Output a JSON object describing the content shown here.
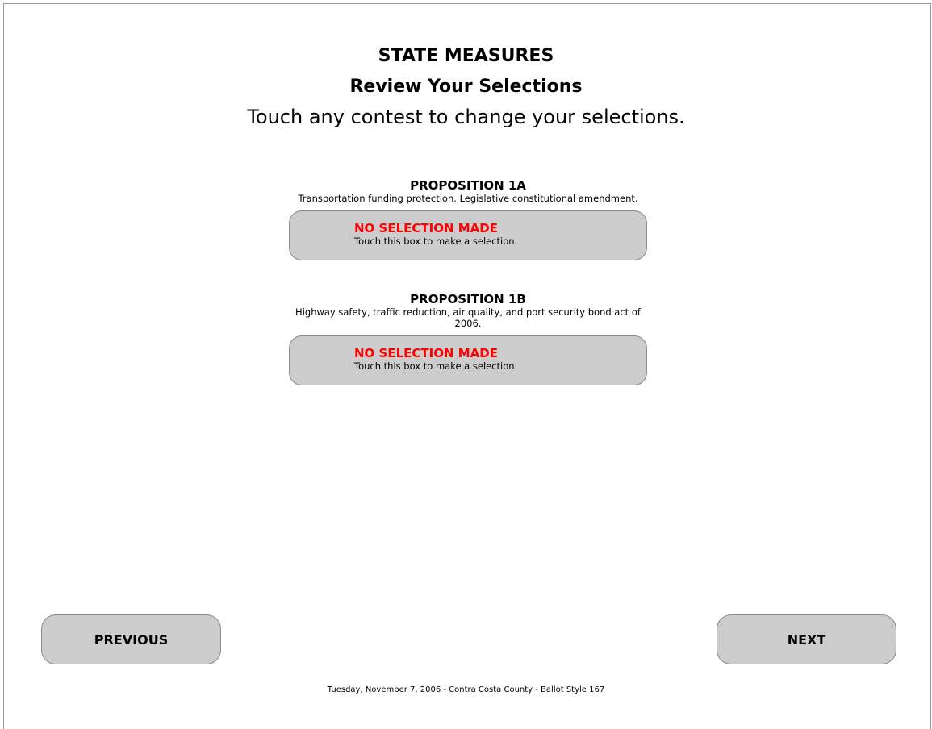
{
  "header": {
    "section_title": "STATE MEASURES",
    "subtitle": "Review Your Selections",
    "instruction": "Touch any contest to change your selections."
  },
  "contests": [
    {
      "title": "PROPOSITION 1A",
      "description": "Transportation funding protection. Legislative constitutional amendment.",
      "selection_status": "NO SELECTION MADE",
      "selection_hint": "Touch this box to make a selection."
    },
    {
      "title": "PROPOSITION 1B",
      "description": "Highway safety, traffic reduction, air quality, and port security bond act of 2006.",
      "selection_status": "NO SELECTION MADE",
      "selection_hint": "Touch this box to make a selection."
    }
  ],
  "nav": {
    "previous_label": "PREVIOUS",
    "next_label": "NEXT"
  },
  "footer": {
    "text": "Tuesday, November 7, 2006 - Contra Costa County - Ballot Style 167"
  },
  "colors": {
    "button_bg": "#cccccc",
    "no_selection": "#ff0000"
  }
}
